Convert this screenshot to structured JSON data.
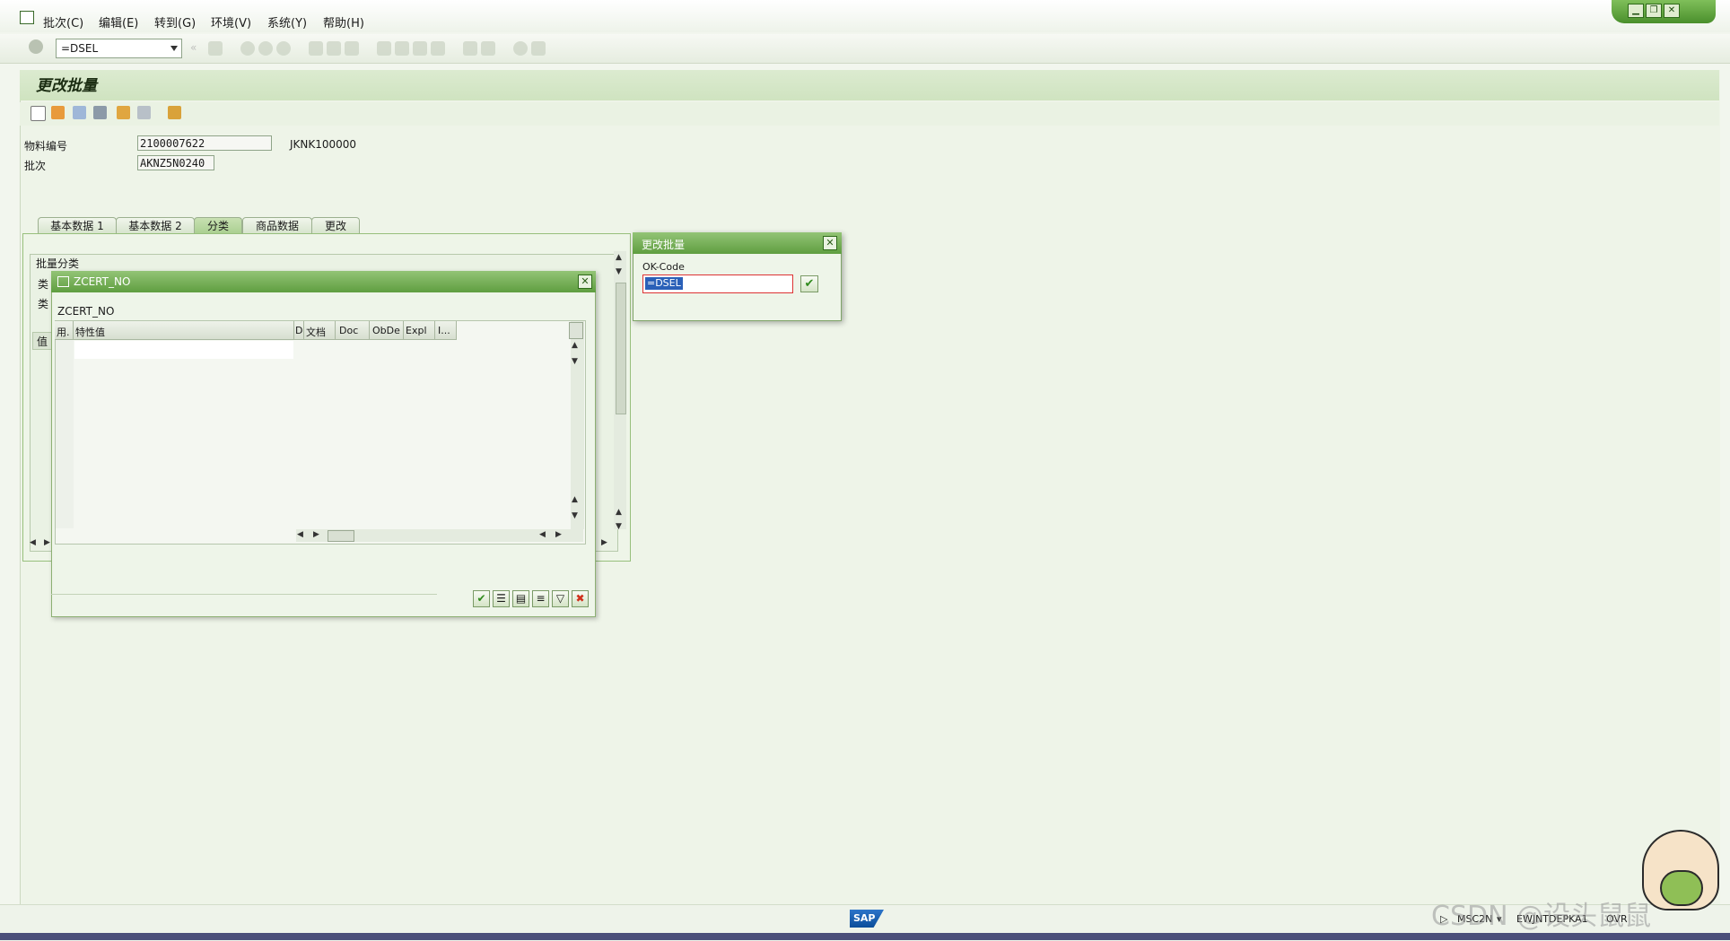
{
  "menu": {
    "items": [
      "批次(C)",
      "编辑(E)",
      "转到(G)",
      "环境(V)",
      "系统(Y)",
      "帮助(H)"
    ]
  },
  "toolbar": {
    "command_value": "=DSEL"
  },
  "page": {
    "title": "更改批量"
  },
  "fields": {
    "material_label": "物料编号",
    "material_value": "2100007622",
    "material_desc": "JKNK100000",
    "batch_label": "批次",
    "batch_value": "AKNZ5N0240"
  },
  "tabs": [
    {
      "label": "基本数据 1",
      "active": false
    },
    {
      "label": "基本数据 2",
      "active": false
    },
    {
      "label": "分类",
      "active": true
    },
    {
      "label": "商品数据",
      "active": false
    },
    {
      "label": "更改",
      "active": false
    }
  ],
  "classification": {
    "group_title": "批量分类",
    "hidden_labels": [
      "类",
      "类",
      "值"
    ]
  },
  "zcert_popup": {
    "title": "ZCERT_NO",
    "subtitle": "ZCERT_NO",
    "columns": [
      "用.",
      "特性值",
      "D",
      "文档",
      "Doc",
      "ObDe",
      "Expl",
      "I..."
    ]
  },
  "change_dialog": {
    "title": "更改批量",
    "okcode_label": "OK-Code",
    "okcode_value": "=DSEL"
  },
  "status": {
    "logo": "SAP",
    "transaction": "MSC2N",
    "system": "EWJNTDEPKA1",
    "mode": "OVR"
  },
  "watermark": "CSDN @设头鼠鼠"
}
